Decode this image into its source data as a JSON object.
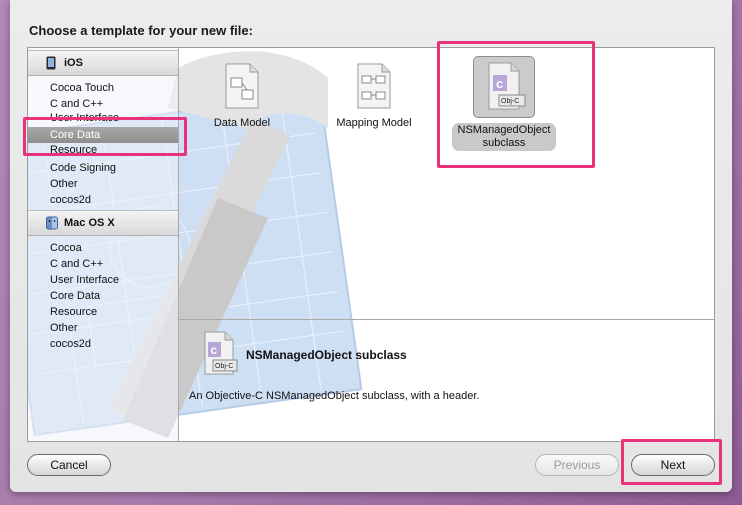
{
  "dialog": {
    "heading": "Choose a template for your new file:"
  },
  "sidebar": {
    "groups": [
      {
        "title": "iOS",
        "items": [
          "Cocoa Touch",
          "C and C++",
          "User Interface",
          "Core Data",
          "Resource",
          "Code Signing",
          "Other",
          "cocos2d"
        ]
      },
      {
        "title": "Mac OS X",
        "items": [
          "Cocoa",
          "C and C++",
          "User Interface",
          "Core Data",
          "Resource",
          "Other",
          "cocos2d"
        ]
      }
    ],
    "selected": "Core Data"
  },
  "templates": [
    {
      "label": "Data Model",
      "icon": "data-model-document-icon"
    },
    {
      "label": "Mapping Model",
      "icon": "mapping-model-document-icon"
    },
    {
      "label_line1": "NSManagedObject",
      "label_line2": "subclass",
      "icon": "objc-document-icon",
      "badge": "Obj-C",
      "selected": true
    }
  ],
  "detail": {
    "title": "NSManagedObject subclass",
    "description": "An Objective-C NSManagedObject subclass, with a header.",
    "badge": "Obj-C"
  },
  "buttons": {
    "cancel": "Cancel",
    "previous": "Previous",
    "next": "Next"
  },
  "colors": {
    "highlight": "#e8337a",
    "desktop": "#a679aa",
    "selection": "#9a9a9a"
  }
}
